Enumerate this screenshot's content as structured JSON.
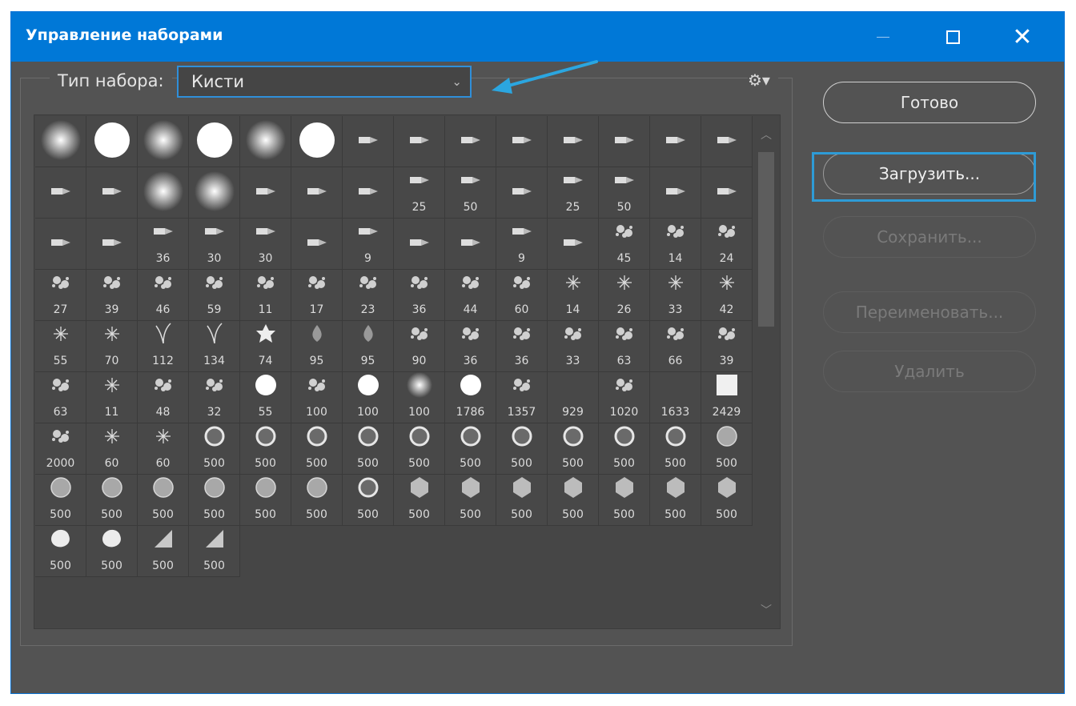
{
  "window": {
    "title": "Управление наборами"
  },
  "preset_type": {
    "label": "Тип набора:",
    "value": "Кисти"
  },
  "buttons": {
    "done": "Готово",
    "load": "Загрузить...",
    "save": "Сохранить...",
    "rename": "Переименовать...",
    "delete": "Удалить"
  },
  "brushes": [
    {
      "shape": "soft",
      "size": ""
    },
    {
      "shape": "hard",
      "size": ""
    },
    {
      "shape": "soft",
      "size": ""
    },
    {
      "shape": "hard",
      "size": ""
    },
    {
      "shape": "soft",
      "size": ""
    },
    {
      "shape": "hard",
      "size": ""
    },
    {
      "shape": "tip",
      "size": ""
    },
    {
      "shape": "tip",
      "size": ""
    },
    {
      "shape": "tip",
      "size": ""
    },
    {
      "shape": "tip",
      "size": ""
    },
    {
      "shape": "tip",
      "size": ""
    },
    {
      "shape": "tip",
      "size": ""
    },
    {
      "shape": "tip",
      "size": ""
    },
    {
      "shape": "tip",
      "size": ""
    },
    {
      "shape": "tip",
      "size": ""
    },
    {
      "shape": "tip",
      "size": ""
    },
    {
      "shape": "soft",
      "size": ""
    },
    {
      "shape": "soft",
      "size": ""
    },
    {
      "shape": "tip",
      "size": ""
    },
    {
      "shape": "tip",
      "size": ""
    },
    {
      "shape": "tip",
      "size": ""
    },
    {
      "shape": "tip",
      "size": "25"
    },
    {
      "shape": "tip",
      "size": "50"
    },
    {
      "shape": "tip",
      "size": ""
    },
    {
      "shape": "tip",
      "size": "25"
    },
    {
      "shape": "tip",
      "size": "50"
    },
    {
      "shape": "tip",
      "size": ""
    },
    {
      "shape": "tip",
      "size": ""
    },
    {
      "shape": "tip",
      "size": ""
    },
    {
      "shape": "tip",
      "size": ""
    },
    {
      "shape": "tip",
      "size": "36"
    },
    {
      "shape": "tip",
      "size": "30"
    },
    {
      "shape": "tip",
      "size": "30"
    },
    {
      "shape": "tip",
      "size": ""
    },
    {
      "shape": "tip",
      "size": "9"
    },
    {
      "shape": "tip",
      "size": ""
    },
    {
      "shape": "tip",
      "size": ""
    },
    {
      "shape": "tip",
      "size": "9"
    },
    {
      "shape": "tip",
      "size": ""
    },
    {
      "shape": "splat",
      "size": "45"
    },
    {
      "shape": "splat",
      "size": "14"
    },
    {
      "shape": "splat",
      "size": "24"
    },
    {
      "shape": "splat",
      "size": "27"
    },
    {
      "shape": "splat",
      "size": "39"
    },
    {
      "shape": "splat",
      "size": "46"
    },
    {
      "shape": "splat",
      "size": "59"
    },
    {
      "shape": "splat",
      "size": "11"
    },
    {
      "shape": "splat",
      "size": "17"
    },
    {
      "shape": "splat",
      "size": "23"
    },
    {
      "shape": "splat",
      "size": "36"
    },
    {
      "shape": "splat",
      "size": "44"
    },
    {
      "shape": "splat",
      "size": "60"
    },
    {
      "shape": "star",
      "size": "14"
    },
    {
      "shape": "star",
      "size": "26"
    },
    {
      "shape": "star",
      "size": "33"
    },
    {
      "shape": "star",
      "size": "42"
    },
    {
      "shape": "star",
      "size": "55"
    },
    {
      "shape": "star",
      "size": "70"
    },
    {
      "shape": "grass",
      "size": "112"
    },
    {
      "shape": "grass",
      "size": "134"
    },
    {
      "shape": "leaf",
      "size": "74"
    },
    {
      "shape": "drop",
      "size": "95"
    },
    {
      "shape": "drop",
      "size": "95"
    },
    {
      "shape": "splat",
      "size": "90"
    },
    {
      "shape": "splat",
      "size": "36"
    },
    {
      "shape": "splat",
      "size": "36"
    },
    {
      "shape": "splat",
      "size": "33"
    },
    {
      "shape": "splat",
      "size": "63"
    },
    {
      "shape": "splat",
      "size": "66"
    },
    {
      "shape": "splat",
      "size": "39"
    },
    {
      "shape": "splat",
      "size": "63"
    },
    {
      "shape": "star",
      "size": "11"
    },
    {
      "shape": "splat",
      "size": "48"
    },
    {
      "shape": "splat",
      "size": "32"
    },
    {
      "shape": "hard",
      "size": "55"
    },
    {
      "shape": "splat",
      "size": "100"
    },
    {
      "shape": "hard",
      "size": "100"
    },
    {
      "shape": "soft",
      "size": "100"
    },
    {
      "shape": "hard",
      "size": "1786"
    },
    {
      "shape": "splat",
      "size": "1357"
    },
    {
      "shape": "blank",
      "size": "929"
    },
    {
      "shape": "splat",
      "size": "1020"
    },
    {
      "shape": "blank",
      "size": "1633"
    },
    {
      "shape": "square",
      "size": "2429"
    },
    {
      "shape": "splat",
      "size": "2000"
    },
    {
      "shape": "star",
      "size": "60"
    },
    {
      "shape": "star",
      "size": "60"
    },
    {
      "shape": "ring",
      "size": "500"
    },
    {
      "shape": "ring",
      "size": "500"
    },
    {
      "shape": "ring",
      "size": "500"
    },
    {
      "shape": "ring",
      "size": "500"
    },
    {
      "shape": "ring",
      "size": "500"
    },
    {
      "shape": "ring",
      "size": "500"
    },
    {
      "shape": "ring",
      "size": "500"
    },
    {
      "shape": "ring",
      "size": "500"
    },
    {
      "shape": "ring",
      "size": "500"
    },
    {
      "shape": "ring",
      "size": "500"
    },
    {
      "shape": "disc",
      "size": "500"
    },
    {
      "shape": "disc",
      "size": "500"
    },
    {
      "shape": "disc",
      "size": "500"
    },
    {
      "shape": "disc",
      "size": "500"
    },
    {
      "shape": "disc",
      "size": "500"
    },
    {
      "shape": "disc",
      "size": "500"
    },
    {
      "shape": "disc",
      "size": "500"
    },
    {
      "shape": "ring",
      "size": "500"
    },
    {
      "shape": "hex",
      "size": "500"
    },
    {
      "shape": "hex",
      "size": "500"
    },
    {
      "shape": "hex",
      "size": "500"
    },
    {
      "shape": "hex",
      "size": "500"
    },
    {
      "shape": "hex",
      "size": "500"
    },
    {
      "shape": "hex",
      "size": "500"
    },
    {
      "shape": "hex",
      "size": "500"
    },
    {
      "shape": "blob",
      "size": "500"
    },
    {
      "shape": "blob",
      "size": "500"
    },
    {
      "shape": "wedge",
      "size": "500"
    },
    {
      "shape": "wedge",
      "size": "500"
    }
  ],
  "colors": {
    "titlebar": "#0078d7",
    "panel": "#535353",
    "highlight": "#2e9bd6"
  }
}
